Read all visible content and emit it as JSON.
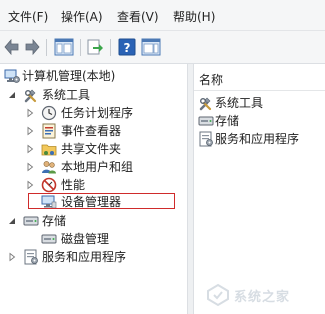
{
  "menu": [
    "文件(F)",
    "操作(A)",
    "查看(V)",
    "帮助(H)"
  ],
  "tree": {
    "root": "计算机管理(本地)",
    "system_tools": "系统工具",
    "task_scheduler": "任务计划程序",
    "event_viewer": "事件查看器",
    "shared_folders": "共享文件夹",
    "local_users": "本地用户和组",
    "performance": "性能",
    "device_manager": "设备管理器",
    "storage": "存储",
    "disk_management": "磁盘管理",
    "services_apps": "服务和应用程序"
  },
  "right_pane": {
    "header": "名称",
    "items": [
      "系统工具",
      "存储",
      "服务和应用程序"
    ]
  },
  "watermark": {
    "text": "系统之家"
  },
  "colors": {
    "highlight": "#cf2b2b",
    "toolbar_bg": "#f5f6f7"
  }
}
